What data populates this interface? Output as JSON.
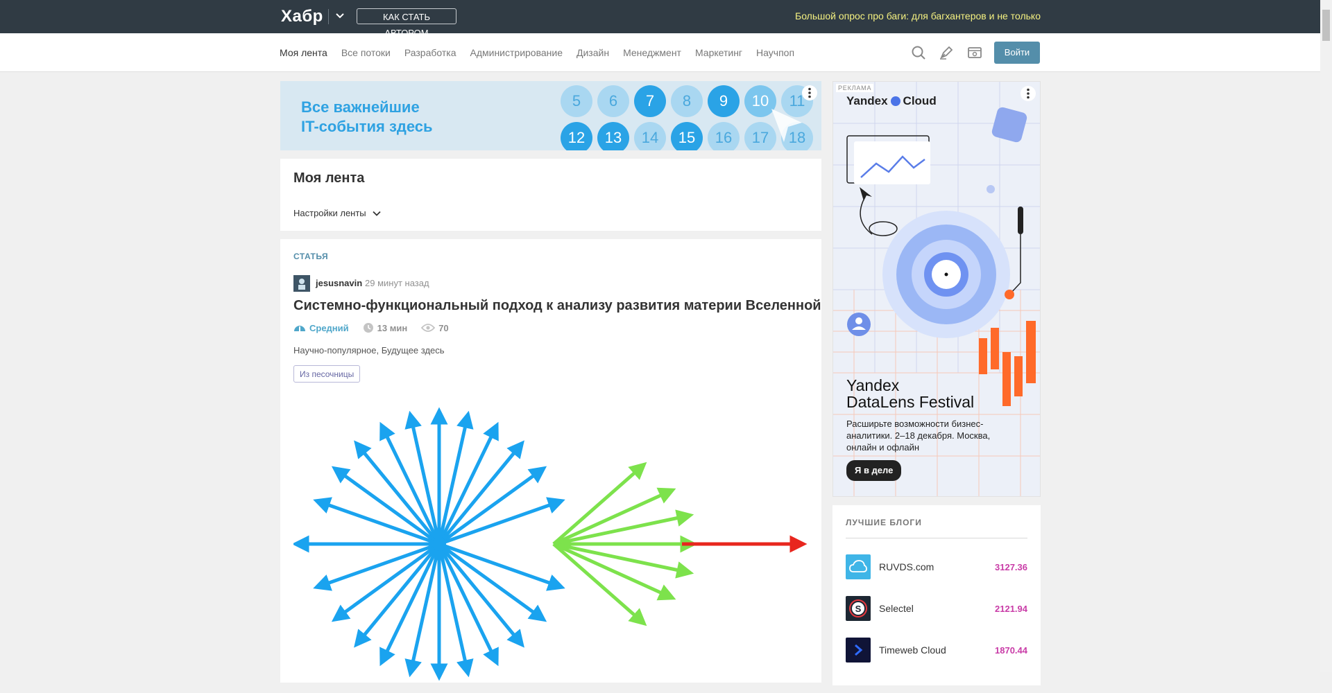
{
  "topbar": {
    "logo": "Хабр",
    "author_button": "КАК СТАТЬ АВТОРОМ",
    "promo_link": "Большой опрос про баги: для багхантеров и не только"
  },
  "nav": {
    "items": [
      {
        "label": "Моя лента",
        "active": true
      },
      {
        "label": "Все потоки"
      },
      {
        "label": "Разработка"
      },
      {
        "label": "Администрирование"
      },
      {
        "label": "Дизайн"
      },
      {
        "label": "Менеджмент"
      },
      {
        "label": "Маркетинг"
      },
      {
        "label": "Научпоп"
      }
    ],
    "login": "Войти",
    "icons": [
      "search-icon",
      "write-icon",
      "reading-mode-icon"
    ]
  },
  "banner": {
    "line1": "Все важнейшие",
    "line2": "IT-события здесь",
    "numbers_row1": [
      "5",
      "6",
      "7",
      "8",
      "9",
      "10",
      "11"
    ],
    "numbers_row2": [
      "12",
      "13",
      "14",
      "15",
      "16",
      "17",
      "18"
    ]
  },
  "feed": {
    "title": "Моя лента",
    "settings": "Настройки ленты"
  },
  "post": {
    "type": "СТАТЬЯ",
    "author": "jesusnavin",
    "time": "29 минут назад",
    "title": "Системно-функциональный подход к анализу развития материи Вселенной",
    "level": "Средний",
    "read_time": "13 мин",
    "views": "70",
    "hubs": [
      "Научно-популярное,",
      "Будущее здесь"
    ],
    "badge": "Из песочницы"
  },
  "ad": {
    "label": "РЕКЛАМА",
    "brand_left": "Yandex",
    "brand_right": "Cloud",
    "title_line1": "Yandex",
    "title_line2": "DataLens Festival",
    "text": "Расширьте возможности бизнес-аналитики. 2–18 декабря. Москва, онлайн и офлайн",
    "button": "Я в деле"
  },
  "blogs": {
    "heading": "ЛУЧШИЕ БЛОГИ",
    "items": [
      {
        "name": "RUVDS.com",
        "score": "3127.36"
      },
      {
        "name": "Selectel",
        "score": "2121.94"
      },
      {
        "name": "Timeweb Cloud",
        "score": "1870.44"
      }
    ]
  },
  "colors": {
    "topbar": "#303b44",
    "accent": "#548eaa",
    "promo": "#f5f181",
    "score": "#c93ca7"
  }
}
